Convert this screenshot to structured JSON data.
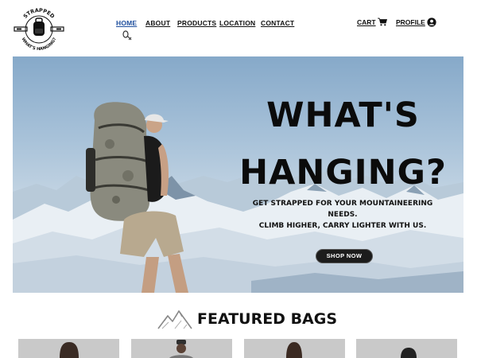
{
  "logo": {
    "top_text": "STRAPPED",
    "bottom_text": "WHAT'S HANGING?",
    "icon": "backpack-icon"
  },
  "nav": {
    "items": [
      {
        "label": "HOME",
        "active": true
      },
      {
        "label": "ABOUT"
      },
      {
        "label": "PRODUCTS"
      },
      {
        "label": "LOCATION"
      },
      {
        "label": "CONTACT"
      }
    ]
  },
  "header": {
    "cart_label": "CART",
    "cart_icon": "shopping-cart-icon",
    "profile_label": "PROFILE",
    "profile_icon": "user-circle-icon"
  },
  "hero": {
    "title_line1": "WHAT'S",
    "title_line2": "HANGING?",
    "subtitle_line1": "GET STRAPPED FOR YOUR MOUNTAINEERING NEEDS.",
    "subtitle_line2": "CLIMB HIGHER, CARRY LIGHTER WITH US.",
    "cta_label": "SHOP NOW"
  },
  "featured": {
    "title": "FEATURED BAGS",
    "icon": "mountains-icon",
    "card_count": 4
  },
  "colors": {
    "active_nav": "#1f4f9e",
    "cta_bg": "#1c1c1c",
    "card_bg": "#c9c9c9"
  }
}
